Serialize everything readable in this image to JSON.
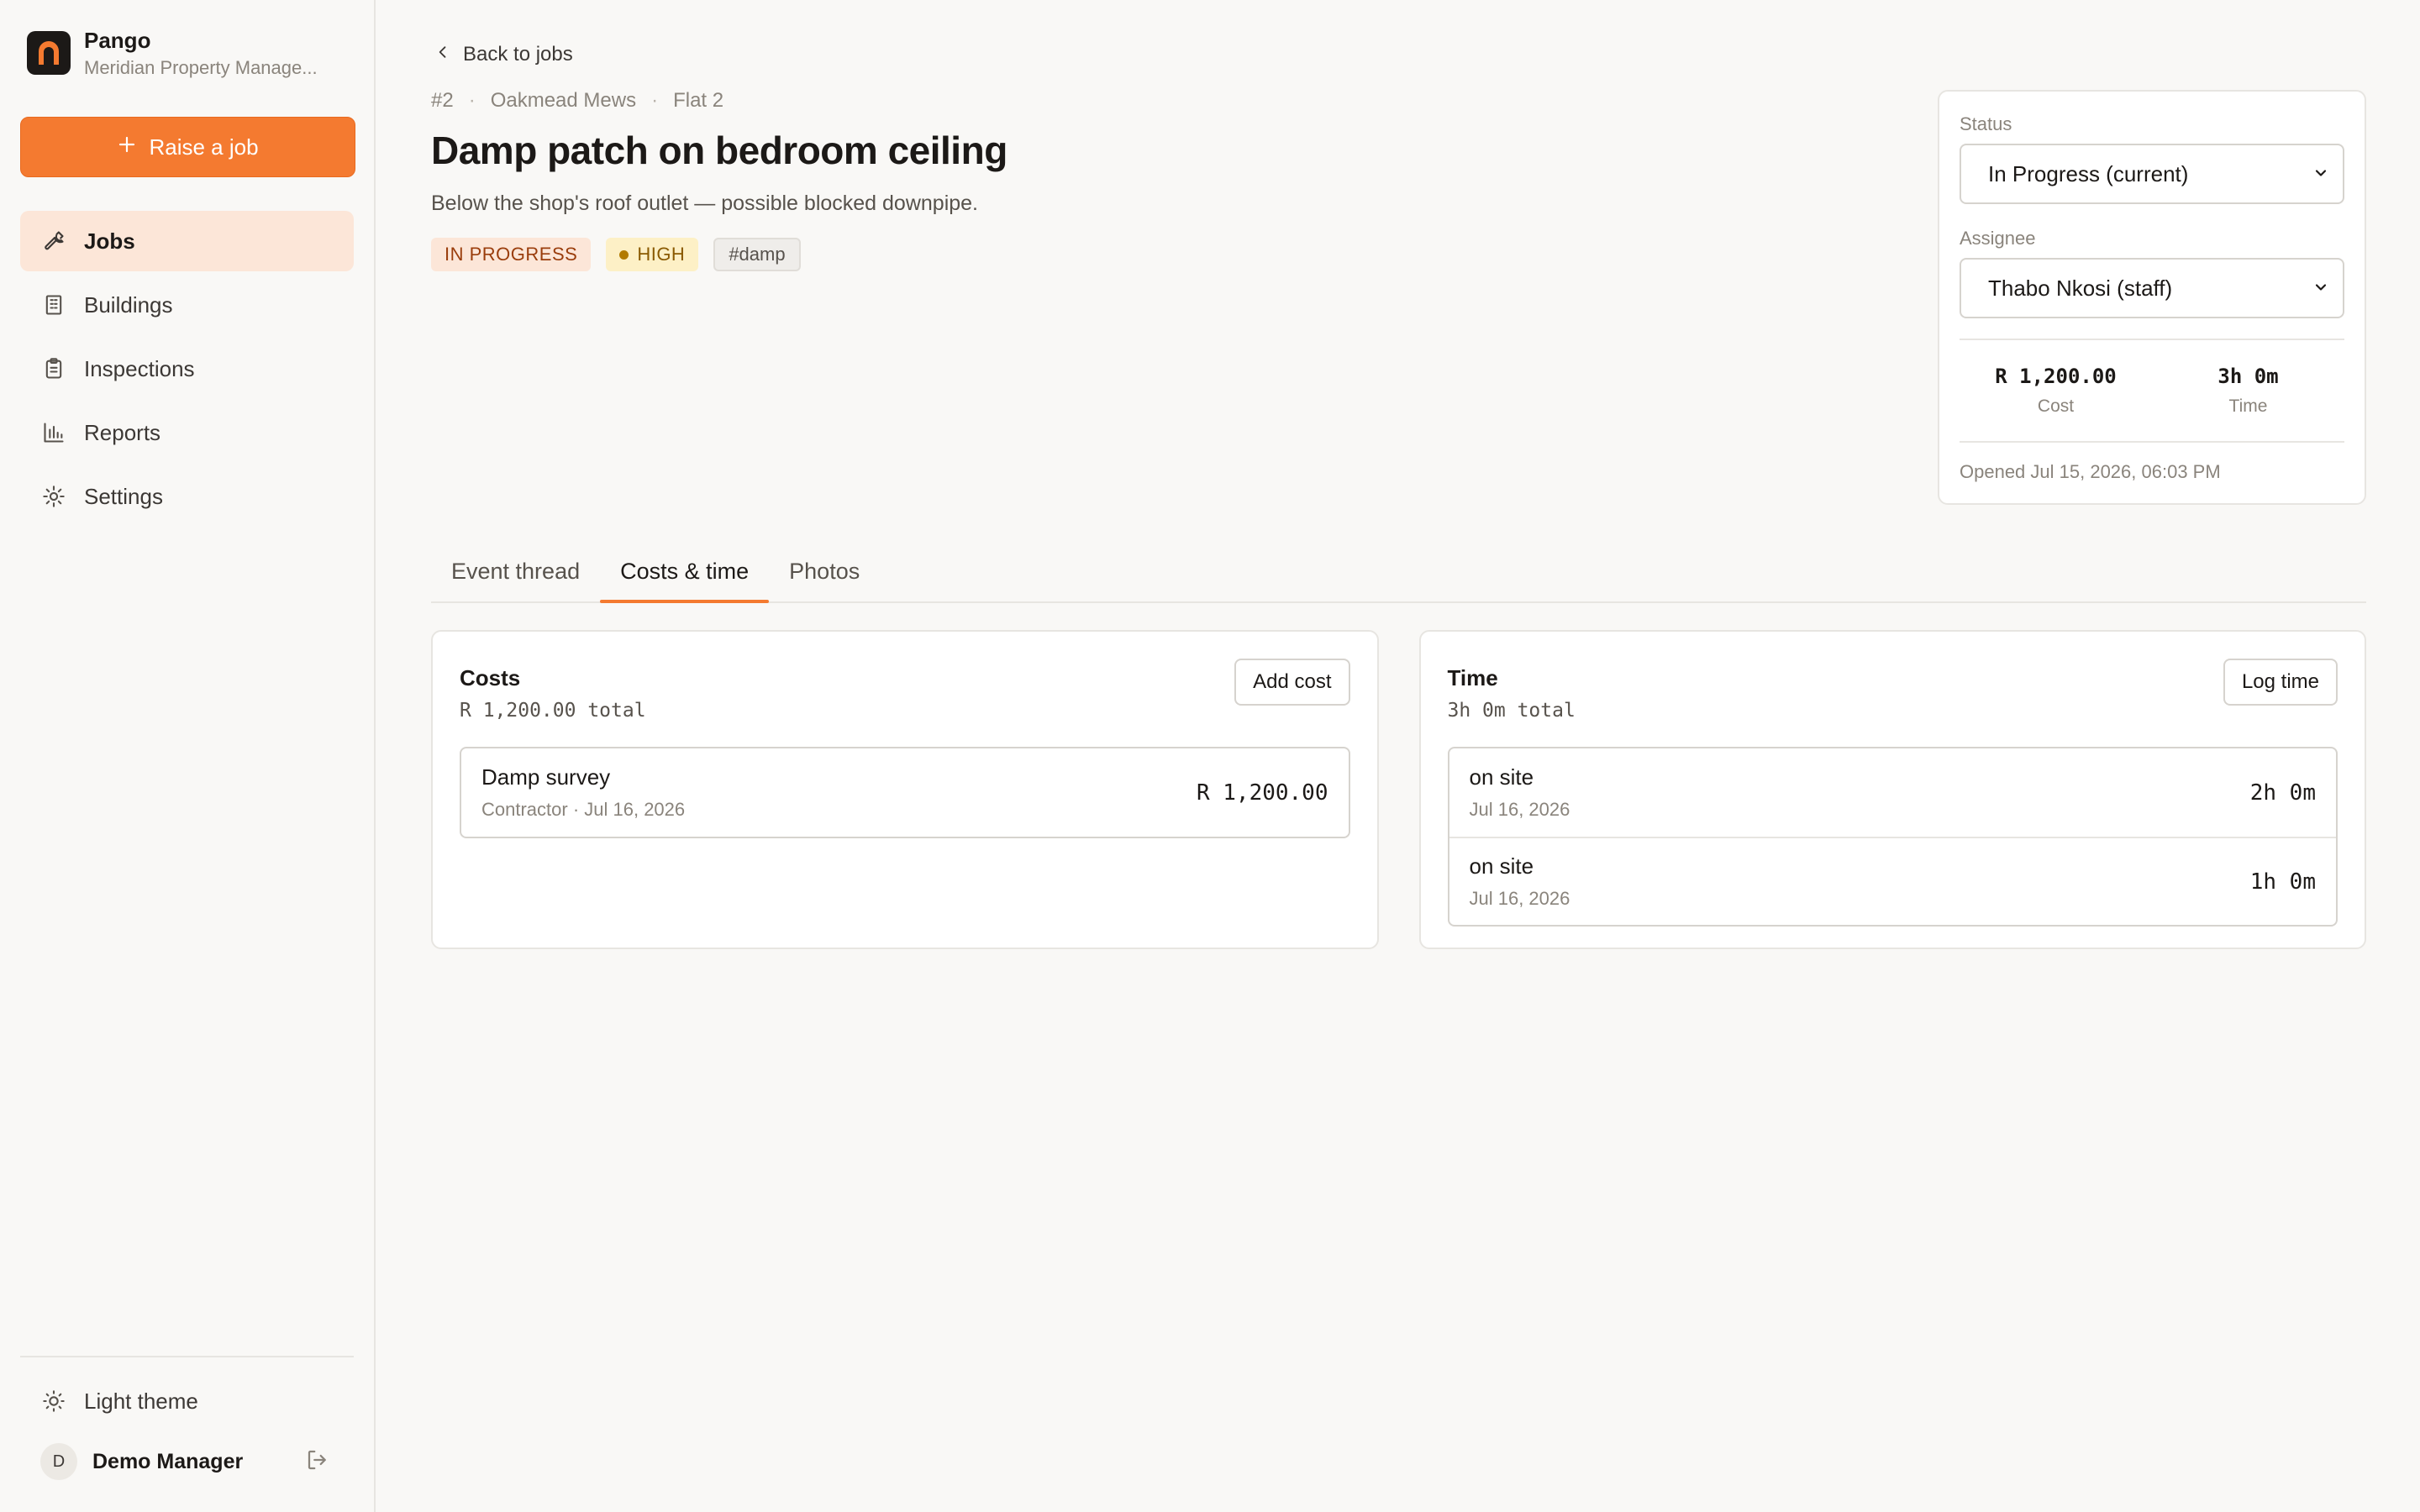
{
  "sidebar": {
    "brand_name": "Pango",
    "brand_org": "Meridian Property Manage...",
    "raise_button": "Raise a job",
    "nav": [
      {
        "label": "Jobs",
        "icon": "wrench-icon",
        "active": true
      },
      {
        "label": "Buildings",
        "icon": "building-icon",
        "active": false
      },
      {
        "label": "Inspections",
        "icon": "clipboard-icon",
        "active": false
      },
      {
        "label": "Reports",
        "icon": "bar-chart-icon",
        "active": false
      },
      {
        "label": "Settings",
        "icon": "gear-icon",
        "active": false
      }
    ],
    "theme_label": "Light theme",
    "user_initial": "D",
    "user_name": "Demo Manager"
  },
  "job": {
    "back_label": "Back to jobs",
    "breadcrumb": [
      "#2",
      "Oakmead Mews",
      "Flat 2"
    ],
    "title": "Damp patch on bedroom ceiling",
    "description": "Below the shop's roof outlet — possible blocked downpipe.",
    "status_badge": "IN PROGRESS",
    "priority_badge": "HIGH",
    "tag": "#damp"
  },
  "side_card": {
    "status_label": "Status",
    "status_value": "In Progress (current)",
    "assignee_label": "Assignee",
    "assignee_value": "Thabo Nkosi (staff)",
    "cost_value": "R 1,200.00",
    "cost_label": "Cost",
    "time_value": "3h 0m",
    "time_label": "Time",
    "opened": "Opened Jul 15, 2026, 06:03 PM"
  },
  "tabs": [
    {
      "label": "Event thread",
      "active": false
    },
    {
      "label": "Costs & time",
      "active": true
    },
    {
      "label": "Photos",
      "active": false
    }
  ],
  "costs": {
    "title": "Costs",
    "total": "R 1,200.00 total",
    "button": "Add cost",
    "items": [
      {
        "title": "Damp survey",
        "sub": "Contractor · Jul 16, 2026",
        "value": "R 1,200.00"
      }
    ]
  },
  "time": {
    "title": "Time",
    "total": "3h 0m total",
    "button": "Log time",
    "items": [
      {
        "title": "on site",
        "sub": "Jul 16, 2026",
        "value": "2h 0m"
      },
      {
        "title": "on site",
        "sub": "Jul 16, 2026",
        "value": "1h 0m"
      }
    ]
  },
  "colors": {
    "accent": "#f47a30",
    "active_nav_bg": "#fce6d8",
    "status_badge_bg": "#fce6d8",
    "priority_badge_bg": "#fdf0c6"
  }
}
